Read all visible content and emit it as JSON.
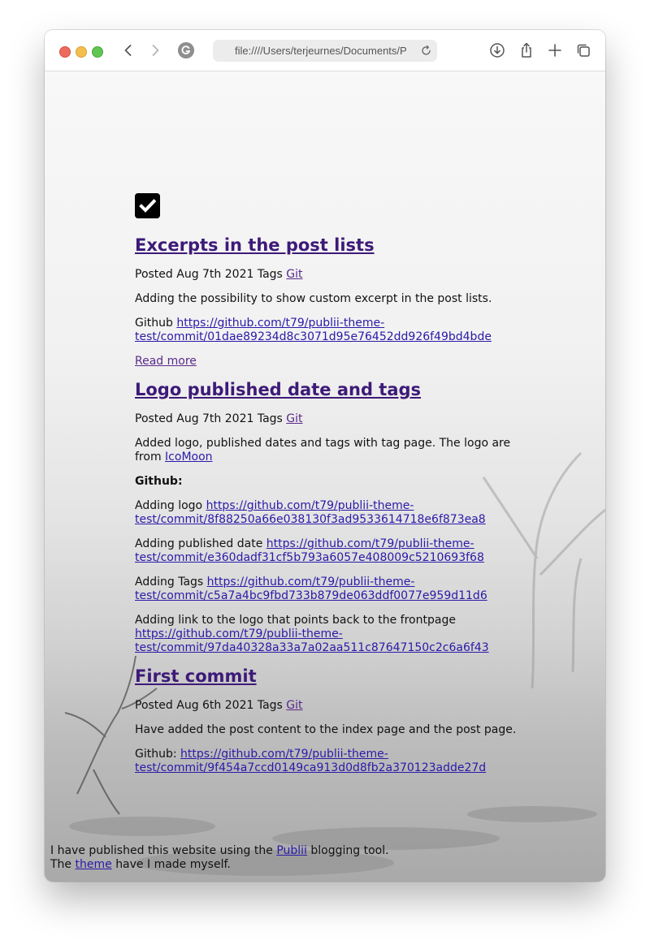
{
  "browser": {
    "url": "file:////Users/terjeurnes/Documents/P"
  },
  "posts": [
    {
      "title": "Excerpts in the post lists",
      "posted": "Posted Aug 7th 2021 Tags",
      "tag": "Git",
      "excerpt": "Adding the possibility to show custom excerpt in the post lists.",
      "github_label": "Github",
      "github_link": "https://github.com/t79/publii-theme-test/commit/01dae89234d8c3071d95e76452dd926f49bd4bde",
      "read_more": "Read more"
    },
    {
      "title": "Logo published date and tags",
      "posted": "Posted Aug 7th 2021 Tags",
      "tag": "Git",
      "text": "Added logo, published dates and tags with tag page. The logo are from",
      "text_link": "IcoMoon",
      "github_heading": "Github:",
      "commits": [
        {
          "label": "Adding logo",
          "link": "https://github.com/t79/publii-theme-test/commit/8f88250a66e038130f3ad9533614718e6f873ea8"
        },
        {
          "label": "Adding published date",
          "link": "https://github.com/t79/publii-theme-test/commit/e360dadf31cf5b793a6057e408009c5210693f68"
        },
        {
          "label": "Adding Tags",
          "link": "https://github.com/t79/publii-theme-test/commit/c5a7a4bc9fbd733b879de063ddf0077e959d11d6"
        },
        {
          "label": "Adding link to the logo that points back to the frontpage",
          "link": "https://github.com/t79/publii-theme-test/commit/97da40328a33a7a02aa511c87647150c2c6a6f43"
        }
      ]
    },
    {
      "title": "First commit",
      "posted": "Posted Aug 6th 2021 Tags",
      "tag": "Git",
      "text": "Have added the post content to the index page and the post page.",
      "github_label": "Github:",
      "github_link": "https://github.com/t79/publii-theme-test/commit/9f454a7ccd0149ca913d0d8fb2a370123adde27d"
    }
  ],
  "footer": {
    "line1_pre": "I have published this website using the",
    "publii": "Publii",
    "line1_post": "blogging tool.",
    "line2_pre": "The",
    "theme": "theme",
    "line2_post": "have I made myself."
  },
  "colors": {
    "title_link": "#3d1a78",
    "link": "#2a1aa8"
  }
}
